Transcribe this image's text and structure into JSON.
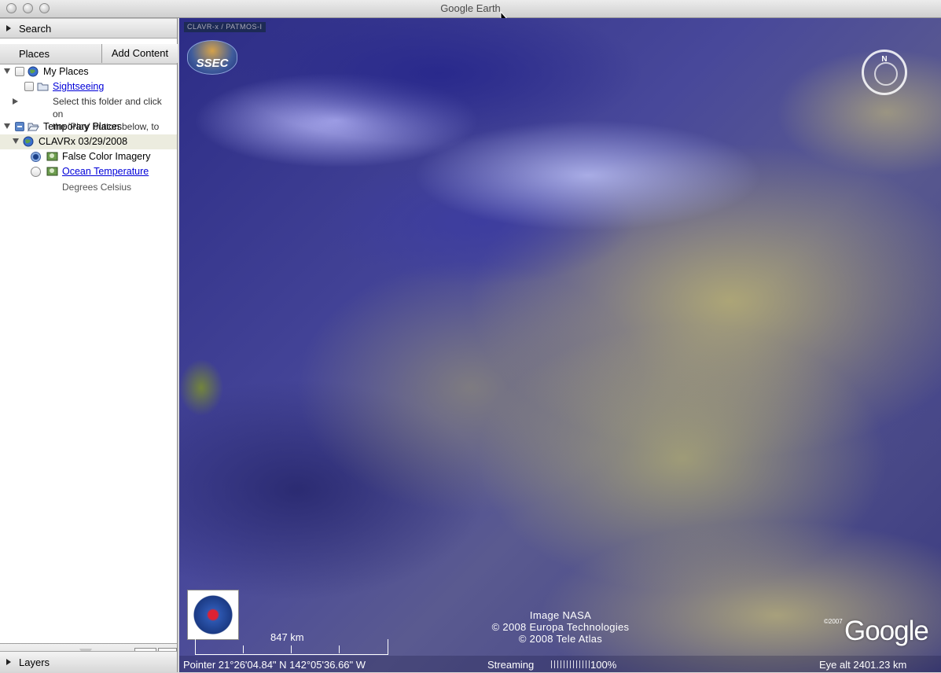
{
  "window": {
    "title": "Google Earth"
  },
  "search": {
    "label": "Search"
  },
  "places": {
    "label": "Places",
    "add_content": "Add Content",
    "my_places": {
      "label": "My Places",
      "sightseeing": "Sightseeing",
      "sightseeing_desc_1": "Select this folder and click on",
      "sightseeing_desc_2": "the 'Play' button below, to"
    },
    "temporary_places": {
      "label": "Temporary Places",
      "clavrx": "CLAVRx 03/29/2008",
      "false_color": "False Color Imagery",
      "ocean_temp": "Ocean Temperature",
      "ocean_temp_desc": "Degrees Celsius"
    }
  },
  "layers": {
    "label": "Layers"
  },
  "map": {
    "overlay_tag": "CLAVR-x / PATMOS-I",
    "ssec_logo": "SSEC",
    "compass_n": "N",
    "scale_label": "847 km",
    "credits": [
      "Image NASA",
      "© 2008 Europa Technologies",
      "© 2008 Tele Atlas"
    ],
    "google_copyright": "©2007",
    "google_logo": "Google",
    "status": {
      "pointer": "Pointer  21°26'04.84\" N  142°05'36.66\" W",
      "streaming_label": "Streaming",
      "streaming_pct": "100%",
      "eye_alt": "Eye alt  2401.23 km"
    }
  }
}
